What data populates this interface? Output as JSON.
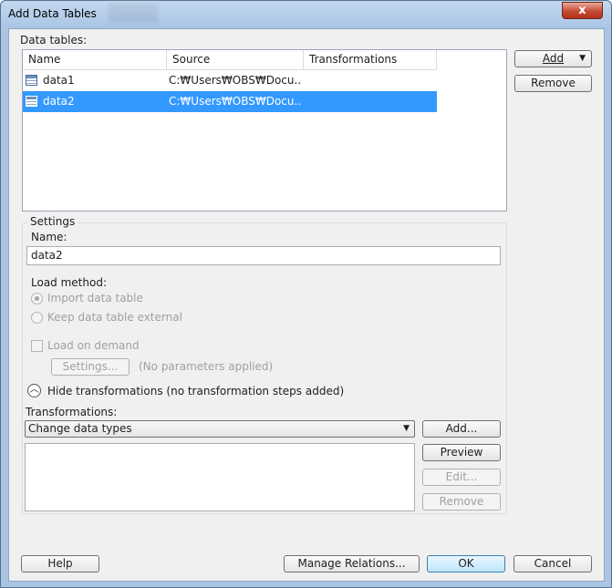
{
  "window": {
    "title": "Add Data Tables",
    "close_glyph": "x"
  },
  "data_tables": {
    "label": "Data tables:",
    "columns": [
      "Name",
      "Source",
      "Transformations"
    ],
    "rows": [
      {
        "name": "data1",
        "source": "C:₩Users₩OBS₩Docu...",
        "transformations": "",
        "selected": false
      },
      {
        "name": "data2",
        "source": "C:₩Users₩OBS₩Docu...",
        "transformations": "",
        "selected": true
      }
    ],
    "add_label": "Add",
    "remove_label": "Remove"
  },
  "settings": {
    "group_label": "Settings",
    "name_label": "Name:",
    "name_value": "data2",
    "load_method_label": "Load method:",
    "import_label": "Import data table",
    "external_label": "Keep data table external",
    "load_on_demand_label": "Load on demand",
    "settings_button": "Settings...",
    "no_params": "(No parameters applied)",
    "hide_transformations": "Hide transformations (no transformation steps added)",
    "transformations_label": "Transformations:",
    "transformation_selected": "Change data types",
    "add_button": "Add...",
    "preview_button": "Preview",
    "edit_button": "Edit...",
    "remove_button": "Remove"
  },
  "footer": {
    "help": "Help",
    "manage_relations": "Manage Relations...",
    "ok": "OK",
    "cancel": "Cancel"
  },
  "colors": {
    "selection": "#3399ff",
    "title_bar": "#a9c5e4",
    "close_button": "#c74a33"
  }
}
